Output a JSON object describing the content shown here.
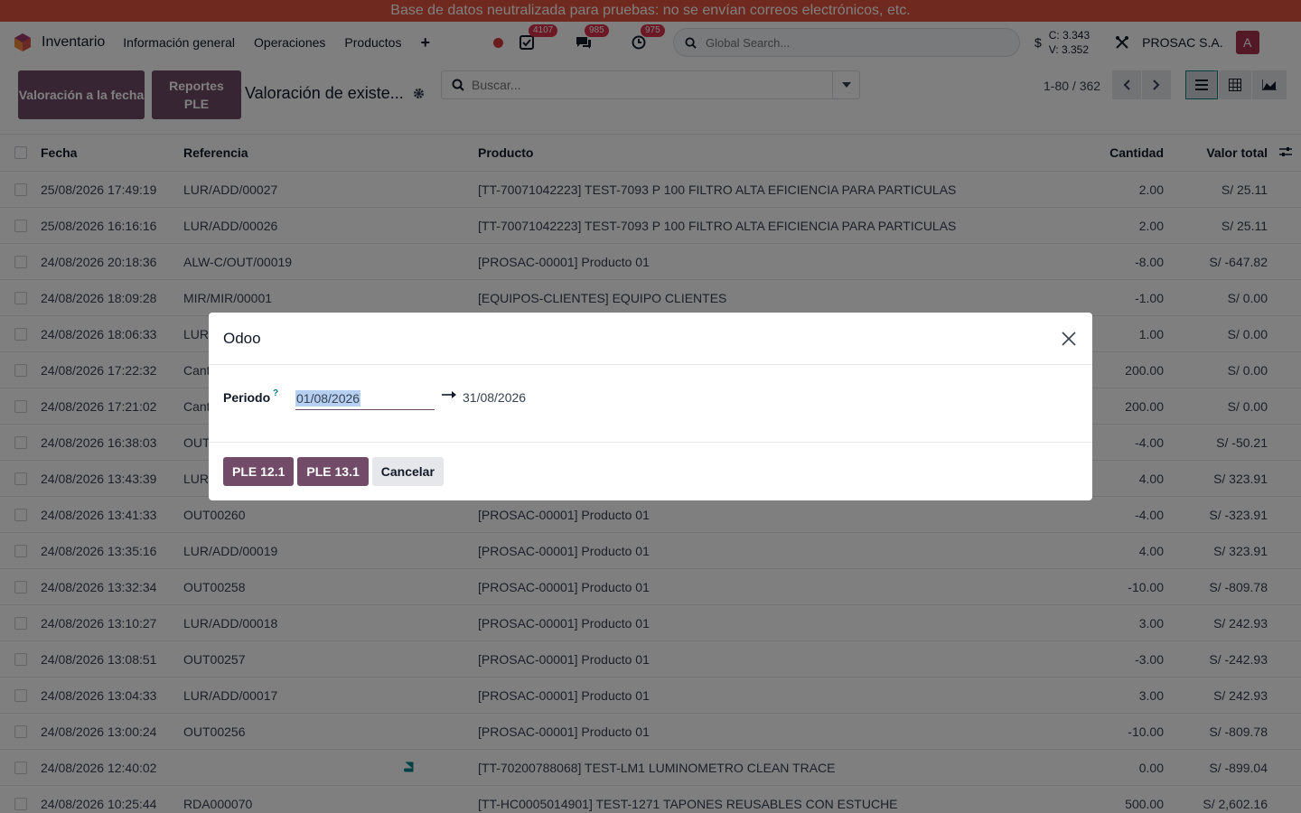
{
  "banner": "Base de datos neutralizada para pruebas: no se envían correos electrónicos, etc.",
  "navbar": {
    "app_name": "Inventario",
    "menu": [
      "Información general",
      "Operaciones",
      "Productos"
    ],
    "badges": {
      "activities": "4107",
      "messages": "985",
      "timer": "975"
    },
    "search_placeholder": "Global Search...",
    "currency_symbol": "$",
    "rate_buy": "C: 3.343",
    "rate_sell": "V: 3.352",
    "company": "PROSAC S.A.",
    "avatar_initial": "A"
  },
  "control": {
    "btn_valuation": "Valoración a la fecha",
    "btn_reports": "Reportes PLE",
    "breadcrumb": "Valoración de existe...",
    "search_placeholder": "Buscar...",
    "pager": "1-80 / 362"
  },
  "table": {
    "headers": {
      "date": "Fecha",
      "ref": "Referencia",
      "product": "Producto",
      "qty": "Cantidad",
      "value": "Valor total"
    },
    "rows": [
      {
        "date": "25/08/2026 17:49:19",
        "ref": "LUR/ADD/00027",
        "product": "[TT-70071042223] TEST-7093 P 100 FILTRO ALTA EFICIENCIA PARA PARTICULAS",
        "qty": "2.00",
        "value": "S/ 25.11"
      },
      {
        "date": "25/08/2026 16:16:16",
        "ref": "LUR/ADD/00026",
        "product": "[TT-70071042223] TEST-7093 P 100 FILTRO ALTA EFICIENCIA PARA PARTICULAS",
        "qty": "2.00",
        "value": "S/ 25.11"
      },
      {
        "date": "24/08/2026 20:18:36",
        "ref": "ALW-C/OUT/00019",
        "product": "[PROSAC-00001] Producto 01",
        "qty": "-8.00",
        "value": "S/ -647.82"
      },
      {
        "date": "24/08/2026 18:09:28",
        "ref": "MIR/MIR/00001",
        "product": "[EQUIPOS-CLIENTES] EQUIPO CLIENTES",
        "qty": "-1.00",
        "value": "S/ 0.00"
      },
      {
        "date": "24/08/2026 18:06:33",
        "ref": "LUR",
        "product": "",
        "qty": "1.00",
        "value": "S/ 0.00"
      },
      {
        "date": "24/08/2026 17:22:32",
        "ref": "Cant",
        "product": "",
        "qty": "200.00",
        "value": "S/ 0.00"
      },
      {
        "date": "24/08/2026 17:21:02",
        "ref": "Cant",
        "product": "",
        "qty": "200.00",
        "value": "S/ 0.00"
      },
      {
        "date": "24/08/2026 16:38:03",
        "ref": "OUT",
        "product": "",
        "qty": "-4.00",
        "value": "S/ -50.21"
      },
      {
        "date": "24/08/2026 13:43:39",
        "ref": "LUR",
        "product": "",
        "qty": "4.00",
        "value": "S/ 323.91"
      },
      {
        "date": "24/08/2026 13:41:33",
        "ref": "OUT00260",
        "product": "[PROSAC-00001] Producto 01",
        "qty": "-4.00",
        "value": "S/ -323.91"
      },
      {
        "date": "24/08/2026 13:35:16",
        "ref": "LUR/ADD/00019",
        "product": "[PROSAC-00001] Producto 01",
        "qty": "4.00",
        "value": "S/ 323.91"
      },
      {
        "date": "24/08/2026 13:32:34",
        "ref": "OUT00258",
        "product": "[PROSAC-00001] Producto 01",
        "qty": "-10.00",
        "value": "S/ -809.78"
      },
      {
        "date": "24/08/2026 13:10:27",
        "ref": "LUR/ADD/00018",
        "product": "[PROSAC-00001] Producto 01",
        "qty": "3.00",
        "value": "S/ 242.93"
      },
      {
        "date": "24/08/2026 13:08:51",
        "ref": "OUT00257",
        "product": "[PROSAC-00001] Producto 01",
        "qty": "-3.00",
        "value": "S/ -242.93"
      },
      {
        "date": "24/08/2026 13:04:33",
        "ref": "LUR/ADD/00017",
        "product": "[PROSAC-00001] Producto 01",
        "qty": "3.00",
        "value": "S/ 242.93"
      },
      {
        "date": "24/08/2026 13:00:24",
        "ref": "OUT00256",
        "product": "[PROSAC-00001] Producto 01",
        "qty": "-10.00",
        "value": "S/ -809.78"
      },
      {
        "date": "24/08/2026 12:40:02",
        "ref": "",
        "product": "[TT-70200788068] TEST-LM1 LUMINOMETRO CLEAN TRACE",
        "qty": "0.00",
        "value": "S/ -899.04"
      },
      {
        "date": "24/08/2026 10:25:44",
        "ref": "RDA000070",
        "product": "[TT-HC0005014901] TEST-1271 TAPONES REUSABLES CON ESTUCHE",
        "qty": "500.00",
        "value": "S/ 2,602.16"
      }
    ]
  },
  "modal": {
    "title": "Odoo",
    "period_label": "Periodo",
    "help_mark": "?",
    "date_from": "01/08/2026",
    "date_to": "31/08/2026",
    "btn_ple121": "PLE 12.1",
    "btn_ple131": "PLE 13.1",
    "btn_cancel": "Cancelar"
  },
  "colors": {
    "primary": "#714b67",
    "banner": "#e0533d",
    "badge": "#d8304a"
  }
}
